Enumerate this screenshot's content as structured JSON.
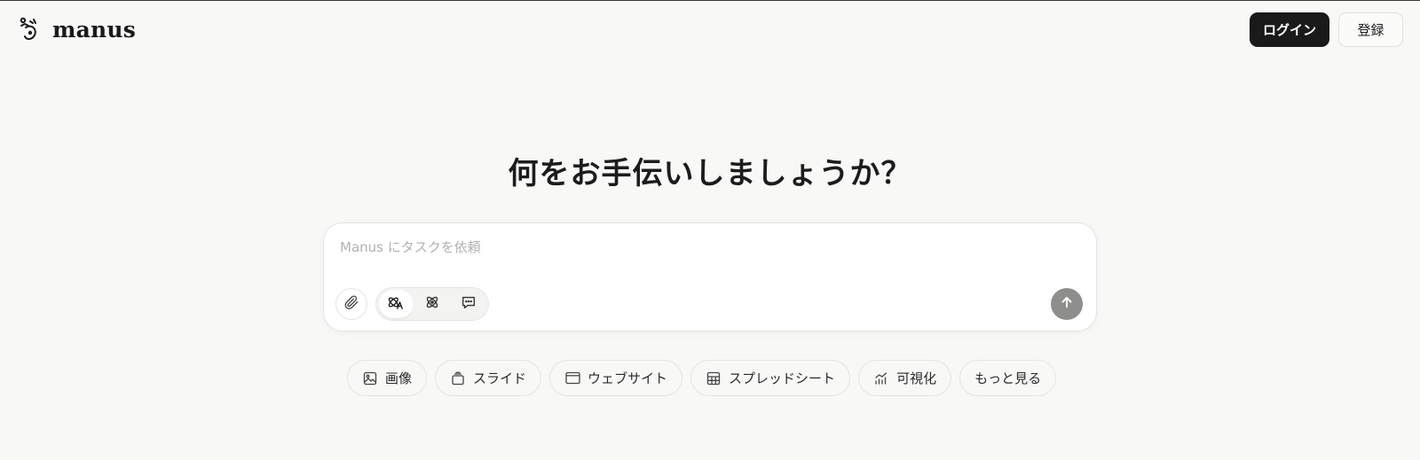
{
  "header": {
    "brand": "manus",
    "login_label": "ログイン",
    "signup_label": "登録"
  },
  "hero": {
    "title": "何をお手伝いしましょうか？"
  },
  "composer": {
    "placeholder": "Manus にタスクを依頼",
    "value": "",
    "modes": [
      {
        "icon": "agent-mode-icon",
        "active": true
      },
      {
        "icon": "atom-icon",
        "active": false
      },
      {
        "icon": "chat-icon",
        "active": false
      }
    ]
  },
  "chips": [
    {
      "label": "画像",
      "icon": "image-icon"
    },
    {
      "label": "スライド",
      "icon": "slides-icon"
    },
    {
      "label": "ウェブサイト",
      "icon": "browser-window-icon"
    },
    {
      "label": "スプレッドシート",
      "icon": "table-icon"
    },
    {
      "label": "可視化",
      "icon": "chart-icon"
    },
    {
      "label": "もっと見る",
      "icon": ""
    }
  ],
  "colors": {
    "background": "#f8f8f7",
    "primary_button": "#1a1a1a",
    "send_button": "#8e8e8c"
  }
}
